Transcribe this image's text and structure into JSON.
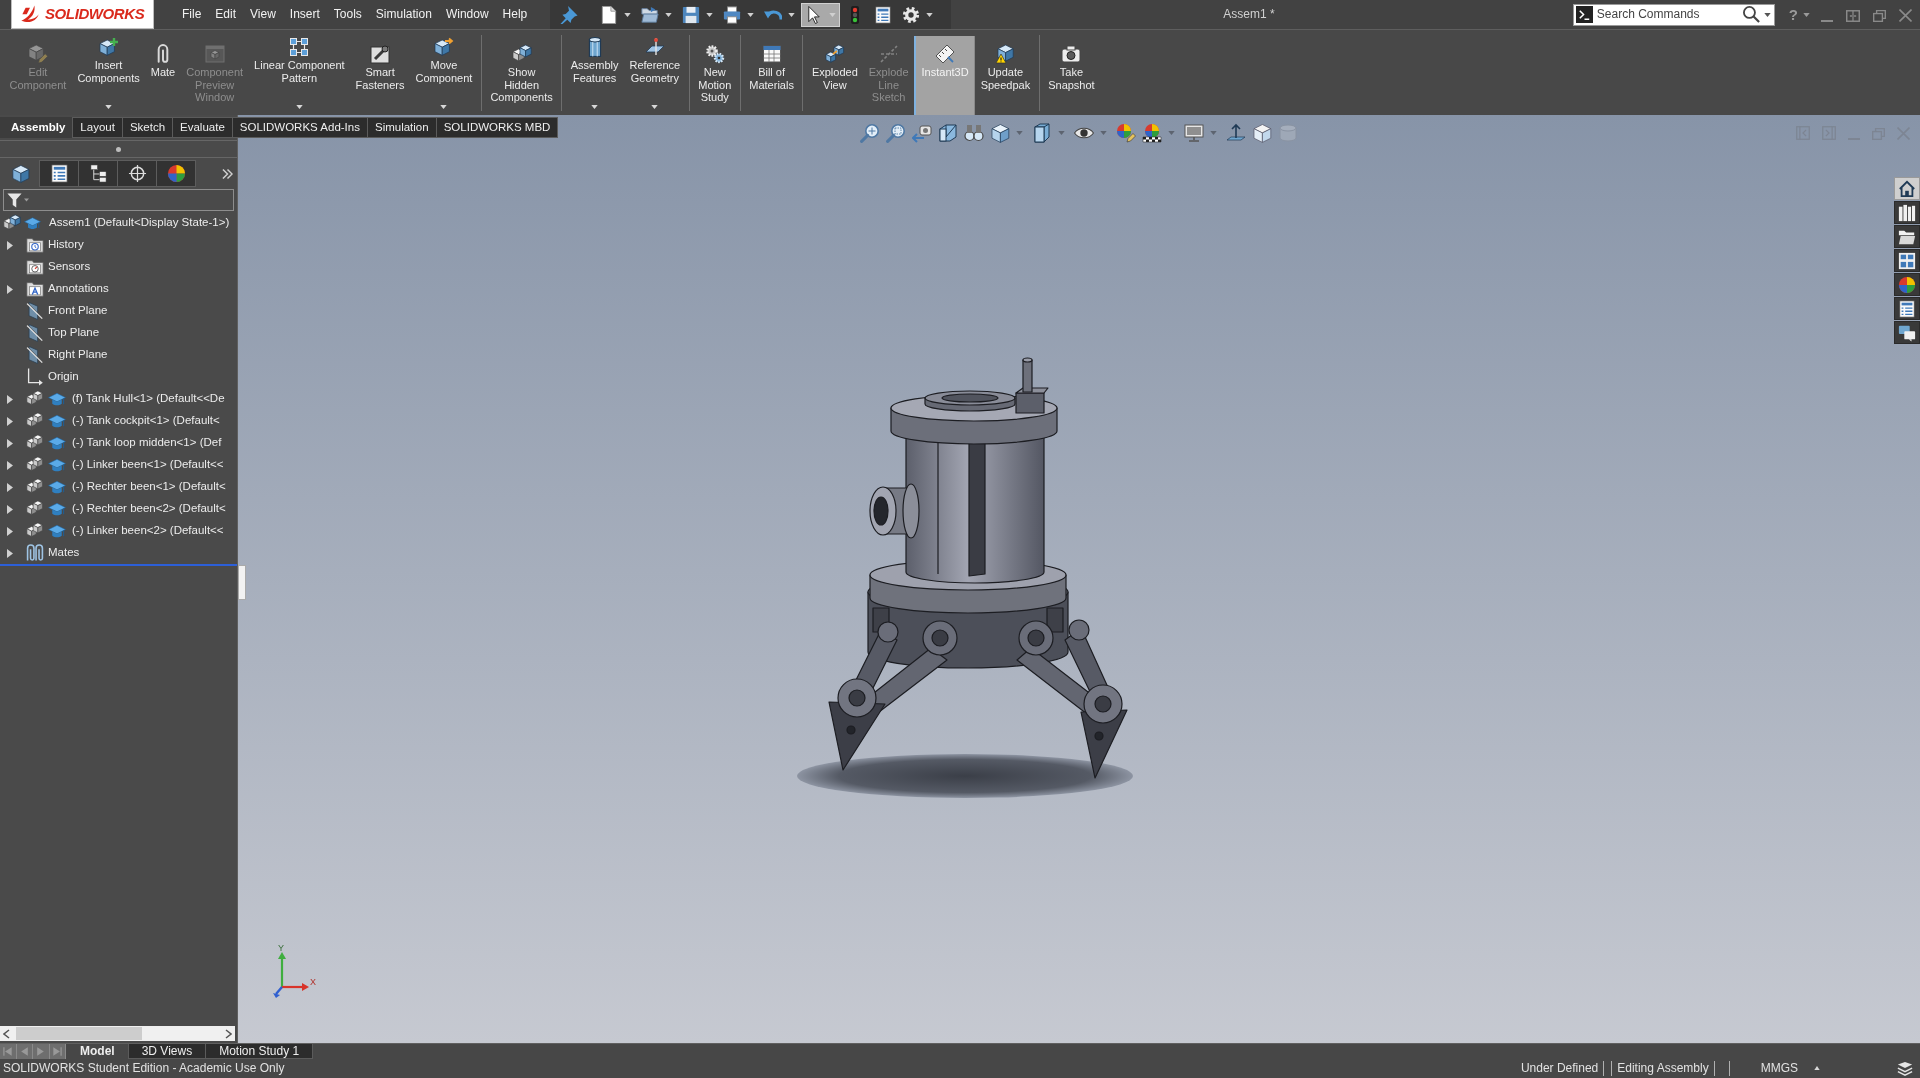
{
  "app_logo": {
    "text": "SOLIDWORKS"
  },
  "menu": [
    "File",
    "Edit",
    "View",
    "Insert",
    "Tools",
    "Simulation",
    "Window",
    "Help"
  ],
  "quick_access": [
    {
      "kind": "pin",
      "dropdown": false,
      "active": false
    },
    {
      "kind": "new",
      "dropdown": true,
      "active": false
    },
    {
      "kind": "open",
      "dropdown": true,
      "active": false
    },
    {
      "kind": "save",
      "dropdown": true,
      "active": false
    },
    {
      "kind": "print",
      "dropdown": true,
      "active": false
    },
    {
      "kind": "undo",
      "dropdown": true,
      "active": false
    },
    {
      "kind": "select",
      "dropdown": true,
      "active": true
    },
    {
      "kind": "rebuild",
      "dropdown": false,
      "active": false
    },
    {
      "kind": "file-properties",
      "dropdown": false,
      "active": false
    },
    {
      "kind": "options",
      "dropdown": true,
      "active": false
    }
  ],
  "window": {
    "title": "Assem1 *",
    "help": "?"
  },
  "search": {
    "placeholder": "Search Commands"
  },
  "ribbon": {
    "groups": [
      [
        {
          "label": "Edit\nComponent",
          "kind": "edit-component",
          "disabled": true,
          "dropdown": false,
          "active": false
        },
        {
          "label": "Insert\nComponents",
          "kind": "insert-components",
          "disabled": false,
          "dropdown": true,
          "active": false
        },
        {
          "label": "Mate",
          "kind": "mate",
          "disabled": false,
          "dropdown": false,
          "active": false
        },
        {
          "label": "Component\nPreview\nWindow",
          "kind": "preview-window",
          "disabled": true,
          "dropdown": false,
          "active": false
        },
        {
          "label": "Linear Component\nPattern",
          "kind": "linear-pattern",
          "disabled": false,
          "dropdown": true,
          "active": false
        },
        {
          "label": "Smart\nFasteners",
          "kind": "smart-fasteners",
          "disabled": false,
          "dropdown": false,
          "active": false
        },
        {
          "label": "Move\nComponent",
          "kind": "move-component",
          "disabled": false,
          "dropdown": true,
          "active": false
        }
      ],
      [
        {
          "label": "Show\nHidden\nComponents",
          "kind": "show-hidden",
          "disabled": false,
          "dropdown": false,
          "active": false
        }
      ],
      [
        {
          "label": "Assembly\nFeatures",
          "kind": "assembly-features",
          "disabled": false,
          "dropdown": true,
          "active": false
        },
        {
          "label": "Reference\nGeometry",
          "kind": "reference-geometry",
          "disabled": false,
          "dropdown": true,
          "active": false
        }
      ],
      [
        {
          "label": "New\nMotion\nStudy",
          "kind": "motion-study",
          "disabled": false,
          "dropdown": false,
          "active": false
        }
      ],
      [
        {
          "label": "Bill of\nMaterials",
          "kind": "bom",
          "disabled": false,
          "dropdown": false,
          "active": false
        }
      ],
      [
        {
          "label": "Exploded\nView",
          "kind": "exploded-view",
          "disabled": false,
          "dropdown": false,
          "active": false
        },
        {
          "label": "Explode\nLine\nSketch",
          "kind": "explode-line",
          "disabled": true,
          "dropdown": false,
          "active": false
        },
        {
          "label": "Instant3D",
          "kind": "instant3d",
          "disabled": false,
          "dropdown": false,
          "active": true
        },
        {
          "label": "Update\nSpeedpak",
          "kind": "speedpak",
          "disabled": false,
          "dropdown": false,
          "active": false
        }
      ],
      [
        {
          "label": "Take\nSnapshot",
          "kind": "snapshot",
          "disabled": false,
          "dropdown": false,
          "active": false
        }
      ]
    ]
  },
  "command_tabs": [
    {
      "label": "Assembly",
      "selected": true
    },
    {
      "label": "Layout",
      "selected": false
    },
    {
      "label": "Sketch",
      "selected": false
    },
    {
      "label": "Evaluate",
      "selected": false
    },
    {
      "label": "SOLIDWORKS Add-Ins",
      "selected": false
    },
    {
      "label": "Simulation",
      "selected": false
    },
    {
      "label": "SOLIDWORKS MBD",
      "selected": false
    }
  ],
  "view_toolbar": [
    {
      "kind": "zoom-fit",
      "dropdown": false,
      "disabled": false
    },
    {
      "kind": "zoom-area",
      "dropdown": false,
      "disabled": false
    },
    {
      "kind": "previous-view",
      "dropdown": false,
      "disabled": false
    },
    {
      "kind": "section-view",
      "dropdown": false,
      "disabled": false
    },
    {
      "kind": "dynamic-annotation",
      "dropdown": false,
      "disabled": false
    },
    {
      "kind": "view-orientation",
      "dropdown": true,
      "disabled": false
    },
    {
      "kind": "display-style",
      "dropdown": true,
      "disabled": false
    },
    {
      "kind": "hide-show",
      "dropdown": true,
      "disabled": false
    },
    {
      "kind": "edit-appearance",
      "dropdown": false,
      "disabled": false
    },
    {
      "kind": "apply-scene",
      "dropdown": true,
      "disabled": false
    },
    {
      "kind": "view-settings",
      "dropdown": true,
      "disabled": false
    },
    {
      "kind": "normal-to",
      "dropdown": false,
      "disabled": false
    },
    {
      "kind": "view-3d",
      "dropdown": false,
      "disabled": false
    },
    {
      "kind": "cylinder",
      "dropdown": false,
      "disabled": true
    }
  ],
  "panel": {
    "tabs": [
      {
        "kind": "feature-manager",
        "selected": true
      },
      {
        "kind": "property-manager",
        "selected": false
      },
      {
        "kind": "configuration-manager",
        "selected": false
      },
      {
        "kind": "dimxpert",
        "selected": false
      },
      {
        "kind": "display-manager",
        "selected": false
      }
    ],
    "tree": {
      "label": "Assem1 (Default<Display State-1>)",
      "kind": "assembly",
      "children": [
        {
          "label": "History",
          "kind": "history",
          "expandable": true
        },
        {
          "label": "Sensors",
          "kind": "sensors",
          "expandable": false
        },
        {
          "label": "Annotations",
          "kind": "annotations",
          "expandable": true
        },
        {
          "label": "Front Plane",
          "kind": "plane",
          "expandable": false
        },
        {
          "label": "Top Plane",
          "kind": "plane",
          "expandable": false
        },
        {
          "label": "Right Plane",
          "kind": "plane",
          "expandable": false
        },
        {
          "label": "Origin",
          "kind": "origin",
          "expandable": false
        },
        {
          "label": "(f) Tank Hull<1> (Default<<De",
          "kind": "component",
          "expandable": true
        },
        {
          "label": "(-) Tank cockpit<1> (Default<",
          "kind": "component",
          "expandable": true
        },
        {
          "label": "(-) Tank loop midden<1> (Def",
          "kind": "component",
          "expandable": true
        },
        {
          "label": "(-) Linker been<1> (Default<<",
          "kind": "component",
          "expandable": true
        },
        {
          "label": "(-) Rechter been<1> (Default<",
          "kind": "component",
          "expandable": true
        },
        {
          "label": "(-) Rechter been<2> (Default<",
          "kind": "component",
          "expandable": true
        },
        {
          "label": "(-) Linker been<2> (Default<<",
          "kind": "component",
          "expandable": true
        },
        {
          "label": "Mates",
          "kind": "mates",
          "expandable": true
        }
      ]
    }
  },
  "task_pane": [
    {
      "kind": "home",
      "selected": true
    },
    {
      "kind": "design-library",
      "selected": false
    },
    {
      "kind": "file-explorer",
      "selected": false
    },
    {
      "kind": "view-palette",
      "selected": false
    },
    {
      "kind": "appearances",
      "selected": false
    },
    {
      "kind": "custom-properties",
      "selected": false
    },
    {
      "kind": "forum",
      "selected": false
    }
  ],
  "triad": {
    "y_label": "Y",
    "x_label": "X"
  },
  "bottom_nav": [
    {
      "kind": "first",
      "disabled": true
    },
    {
      "kind": "previous",
      "disabled": true
    },
    {
      "kind": "next",
      "disabled": true
    },
    {
      "kind": "last",
      "disabled": true
    }
  ],
  "bottom_tabs": [
    {
      "label": "Model",
      "selected": true
    },
    {
      "label": "3D Views",
      "selected": false
    },
    {
      "label": "Motion Study 1",
      "selected": false
    }
  ],
  "status_bar": {
    "text": "SOLIDWORKS Student Edition - Academic Use Only",
    "fields": [
      "Under Defined",
      "Editing Assembly"
    ],
    "units": "MMGS"
  }
}
